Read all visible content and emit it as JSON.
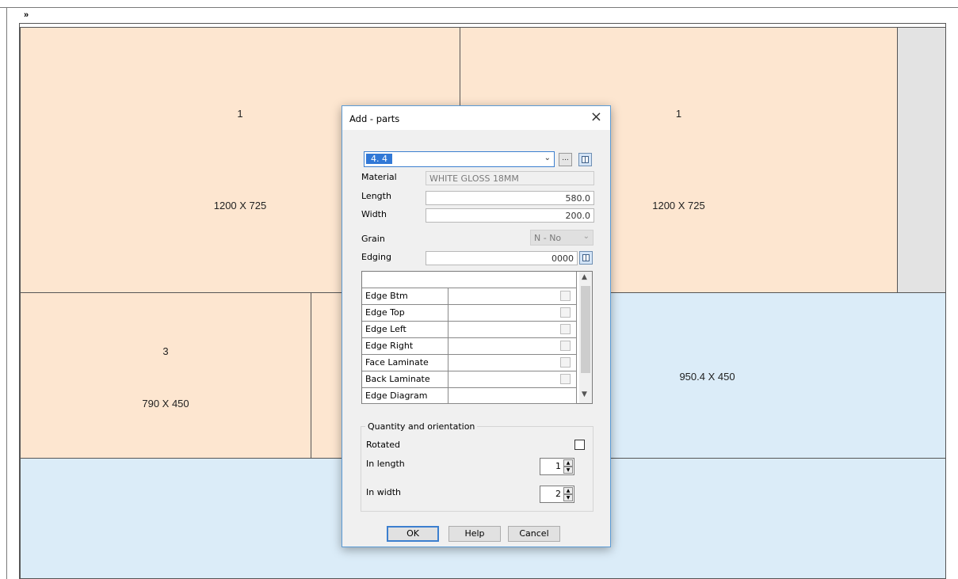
{
  "toolbar_marker": "»",
  "panels": [
    {
      "id": "p1",
      "number": "1",
      "dims": "1200 X 725"
    },
    {
      "id": "p2",
      "number": "1",
      "dims": "1200 X 725"
    },
    {
      "id": "p3",
      "number": "3",
      "dims": "790 X 450"
    },
    {
      "id": "p4",
      "dims": "950.4 X 450"
    }
  ],
  "colors": {
    "part": "#fde6d0",
    "offcut": "#dbecf8",
    "waste": "#e3e3e3",
    "accent": "#3178d6"
  },
  "dialog": {
    "title": "Add - parts",
    "close_icon": "×",
    "part_combo": {
      "value": "4.  4"
    },
    "browse_label": "...",
    "material": {
      "label": "Material",
      "value": "WHITE GLOSS 18MM"
    },
    "length": {
      "label": "Length",
      "value": "580.0"
    },
    "width": {
      "label": "Width",
      "value": "200.0"
    },
    "grain": {
      "label": "Grain",
      "value": "N - No"
    },
    "edging": {
      "label": "Edging",
      "value": "0000"
    },
    "edging_table": {
      "headers": [
        "",
        ""
      ],
      "rows": [
        {
          "label": "Edge Btm",
          "checkbox": true
        },
        {
          "label": "Edge Top",
          "checkbox": true
        },
        {
          "label": "Edge Left",
          "checkbox": true
        },
        {
          "label": "Edge Right",
          "checkbox": true
        },
        {
          "label": "Face Laminate",
          "checkbox": true
        },
        {
          "label": "Back Laminate",
          "checkbox": true
        },
        {
          "label": "Edge Diagram",
          "checkbox": false
        }
      ]
    },
    "quantity_group": {
      "title": "Quantity and orientation",
      "rotated": {
        "label": "Rotated",
        "checked": false
      },
      "in_length": {
        "label": "In length",
        "value": "1"
      },
      "in_width": {
        "label": "In width",
        "value": "2"
      }
    },
    "buttons": {
      "ok": "OK",
      "help": "Help",
      "cancel": "Cancel"
    }
  }
}
